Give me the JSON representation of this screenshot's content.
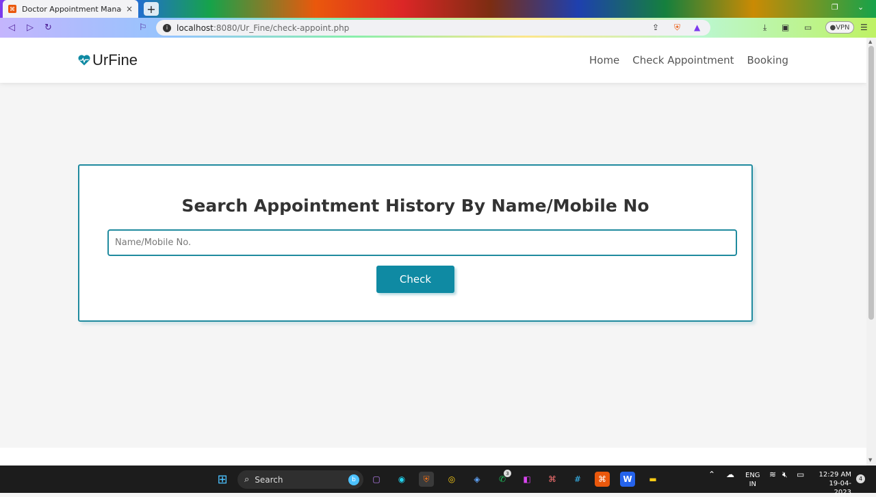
{
  "browser": {
    "tab_title": "Doctor Appointment Managemen",
    "url_host": "localhost",
    "url_path": ":8080/Ur_Fine/check-appoint.php",
    "vpn_label": "VPN"
  },
  "site": {
    "logo_text": "UrFine",
    "nav": [
      "Home",
      "Check Appointment",
      "Booking"
    ]
  },
  "search_card": {
    "heading": "Search Appointment History By Name/Mobile No",
    "input_placeholder": "Name/Mobile No.",
    "input_value": "",
    "button_label": "Check"
  },
  "taskbar": {
    "search_label": "Search",
    "whatsapp_badge": "3",
    "lang_line1": "ENG",
    "lang_line2": "IN",
    "time": "12:29 AM",
    "date": "19-04-2023",
    "notification_count": "4"
  },
  "colors": {
    "accent": "#1f8a9e",
    "button": "#0f8aa3",
    "heading": "#333333"
  }
}
